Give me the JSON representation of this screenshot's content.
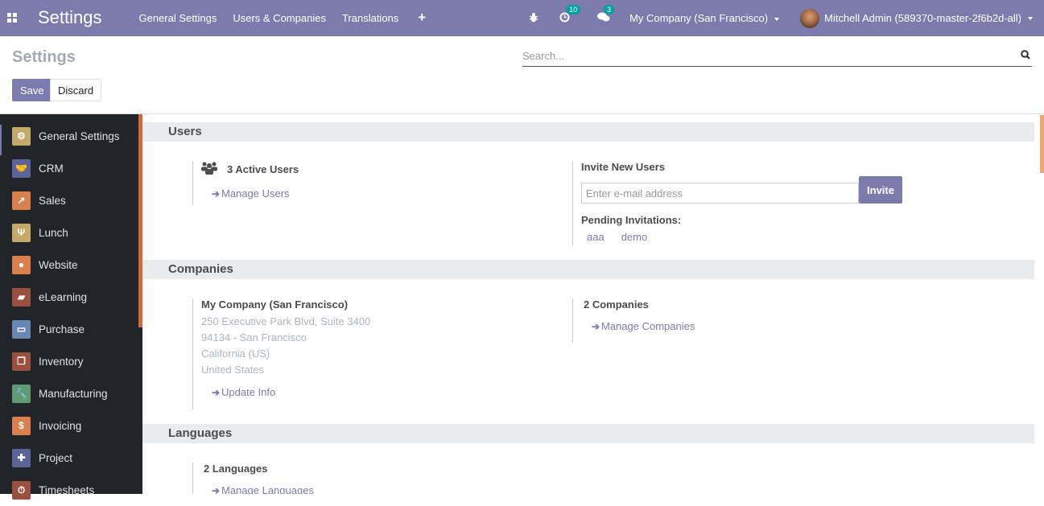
{
  "navbar": {
    "app_title": "Settings",
    "menu": [
      "General Settings",
      "Users & Companies",
      "Translations"
    ],
    "plus_label": "+",
    "activity_count": "10",
    "messages_count": "3",
    "company": "My Company (San Francisco)",
    "user": "Mitchell Admin (589370-master-2f6b2d-all)"
  },
  "control_panel": {
    "title": "Settings",
    "save_label": "Save",
    "discard_label": "Discard",
    "search_placeholder": "Search..."
  },
  "sidebar": {
    "items": [
      {
        "label": "General Settings",
        "icon": "gear-icon",
        "color": "#c4a96a",
        "glyph": "⚙"
      },
      {
        "label": "CRM",
        "icon": "handshake-icon",
        "color": "#5b6399",
        "glyph": "🤝"
      },
      {
        "label": "Sales",
        "icon": "chart-icon",
        "color": "#d9804e",
        "glyph": "↗"
      },
      {
        "label": "Lunch",
        "icon": "cutlery-icon",
        "color": "#c4a96a",
        "glyph": "Ψ"
      },
      {
        "label": "Website",
        "icon": "globe-icon",
        "color": "#d9804e",
        "glyph": "●"
      },
      {
        "label": "eLearning",
        "icon": "elearning-icon",
        "color": "#9b4f3f",
        "glyph": "▰"
      },
      {
        "label": "Purchase",
        "icon": "credit-card-icon",
        "color": "#6a86b5",
        "glyph": "▭"
      },
      {
        "label": "Inventory",
        "icon": "box-icon",
        "color": "#9b4f3f",
        "glyph": "❒"
      },
      {
        "label": "Manufacturing",
        "icon": "wrench-icon",
        "color": "#5e9b72",
        "glyph": "🔧"
      },
      {
        "label": "Invoicing",
        "icon": "invoice-icon",
        "color": "#d9804e",
        "glyph": "$"
      },
      {
        "label": "Project",
        "icon": "puzzle-icon",
        "color": "#5b6399",
        "glyph": "✚"
      },
      {
        "label": "Timesheets",
        "icon": "stopwatch-icon",
        "color": "#9b4f3f",
        "glyph": "⏱"
      }
    ]
  },
  "sections": {
    "users": {
      "title": "Users",
      "active_users": "3 Active Users",
      "manage_users": "Manage Users",
      "invite_title": "Invite New Users",
      "invite_placeholder": "Enter e-mail address",
      "invite_button": "Invite",
      "pending_title": "Pending Invitations:",
      "pending": [
        "aaa",
        "demo"
      ]
    },
    "companies": {
      "title": "Companies",
      "company_name": "My Company (San Francisco)",
      "address": [
        "250 Executive Park Blvd, Suite 3400",
        "94134 - San Francisco",
        "California (US)",
        "United States"
      ],
      "update_info": "Update Info",
      "count": "2 Companies",
      "manage": "Manage Companies"
    },
    "languages": {
      "title": "Languages",
      "count": "2 Languages",
      "manage": "Manage Languages"
    }
  }
}
